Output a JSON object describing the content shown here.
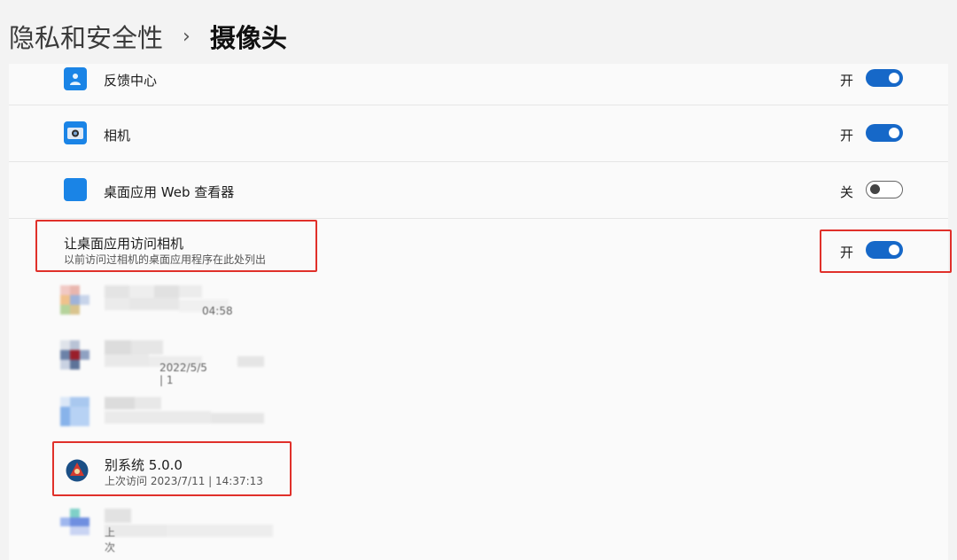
{
  "breadcrumb": {
    "parent": "隐私和安全性",
    "separator": "›",
    "current": "摄像头"
  },
  "apps": [
    {
      "name": "反馈中心",
      "state": "开",
      "on": true,
      "icon": "feedback-hub-icon"
    },
    {
      "name": "相机",
      "state": "开",
      "on": true,
      "icon": "camera-icon"
    },
    {
      "name": "桌面应用 Web 查看器",
      "state": "关",
      "on": false,
      "icon": "web-viewer-icon"
    }
  ],
  "desktop_access": {
    "title": "让桌面应用访问相机",
    "subtitle": "以前访问过相机的桌面应用程序在此处列出",
    "state": "开",
    "on": true
  },
  "desktop_apps": [
    {
      "time_fragment": "04:58"
    },
    {
      "time_fragment": "2022/5/5 | 1"
    },
    {
      "time_fragment": ""
    },
    {
      "name": "别系统 5.0.0",
      "time": "上次访问 2023/7/11 | 14:37:13"
    },
    {
      "time_fragment": "上次"
    }
  ],
  "colors": {
    "accent": "#1668c8",
    "highlight": "#e0302a",
    "app_icon_blue": "#1a84e6"
  }
}
